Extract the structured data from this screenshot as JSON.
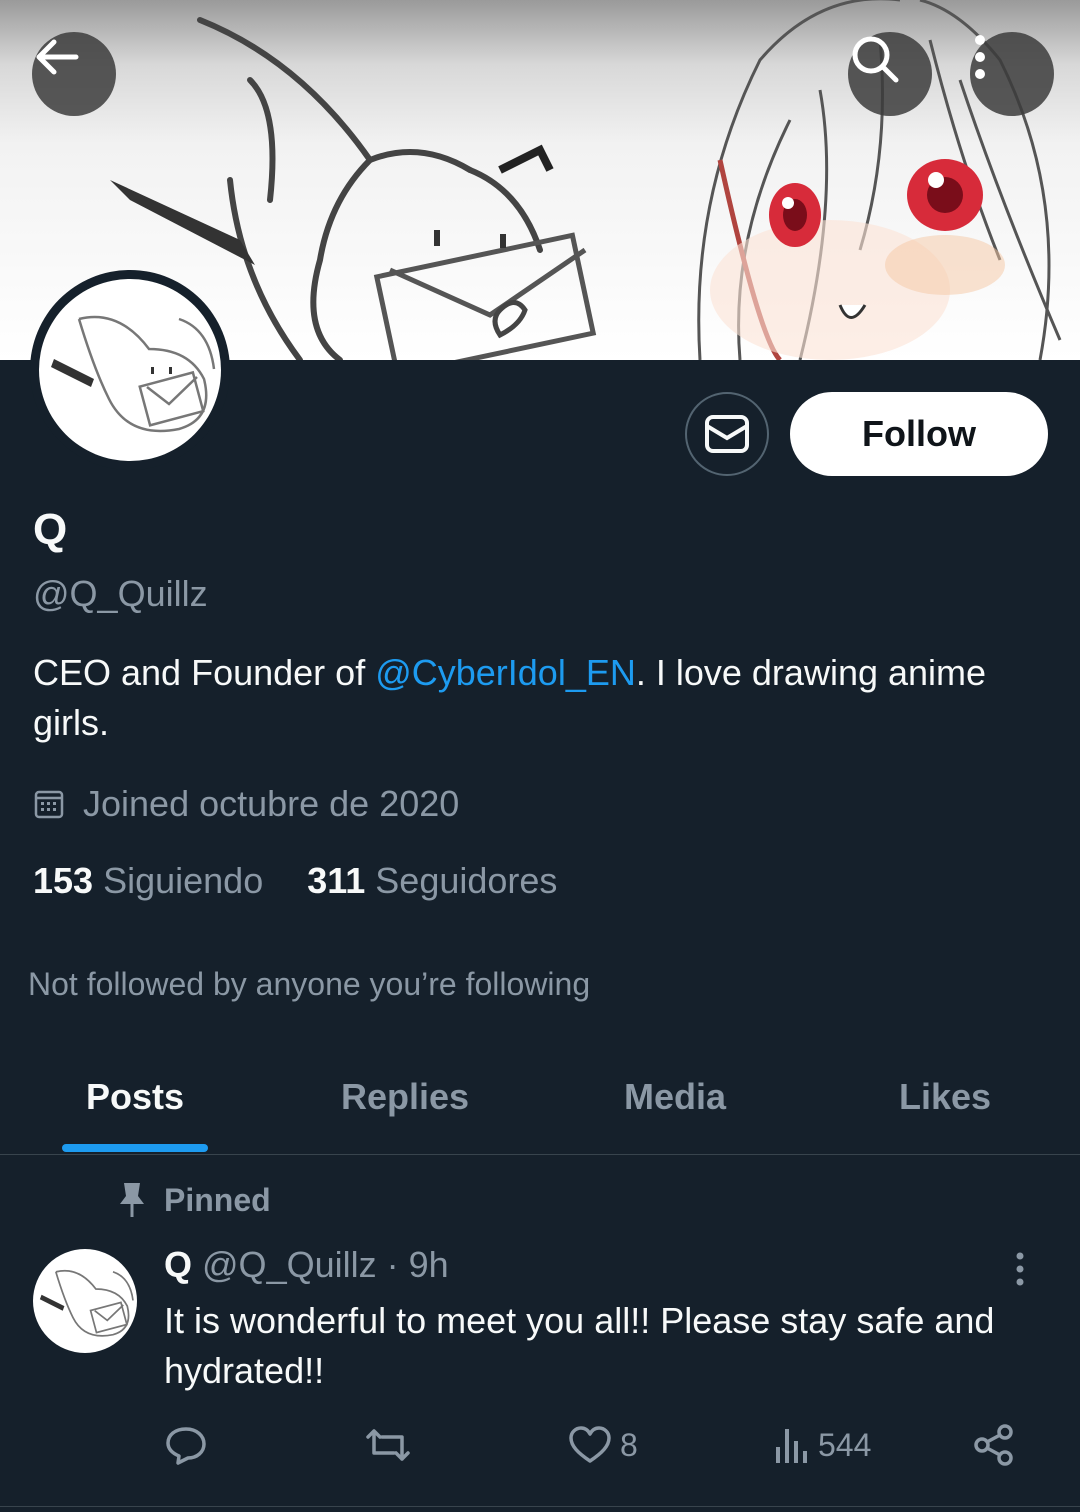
{
  "header": {
    "back_icon": "arrow-left-icon",
    "search_icon": "search-icon",
    "more_icon": "more-vertical-icon"
  },
  "profile": {
    "display_name": "Q",
    "handle": "@Q_Quillz",
    "bio_prefix": "CEO and Founder of ",
    "bio_mention": "@CyberIdol_EN",
    "bio_suffix": ". I love drawing anime girls.",
    "joined": "Joined octubre de 2020",
    "following_count": "153",
    "following_label": "Siguiendo",
    "followers_count": "311",
    "followers_label": "Seguidores",
    "not_followed": "Not followed by anyone you’re following",
    "follow_label": "Follow",
    "message_icon": "envelope-icon"
  },
  "tabs": [
    {
      "label": "Posts",
      "active": true
    },
    {
      "label": "Replies",
      "active": false
    },
    {
      "label": "Media",
      "active": false
    },
    {
      "label": "Likes",
      "active": false
    }
  ],
  "post": {
    "pinned_label": "Pinned",
    "name": "Q",
    "handle_time": "@Q_Quillz · 9h",
    "text": "It is wonderful to meet you all!! Please stay safe and hydrated!!",
    "likes": "8",
    "views": "544"
  },
  "colors": {
    "background": "#15202b",
    "accent": "#1d9bf0",
    "secondary_text": "#8b98a5"
  }
}
